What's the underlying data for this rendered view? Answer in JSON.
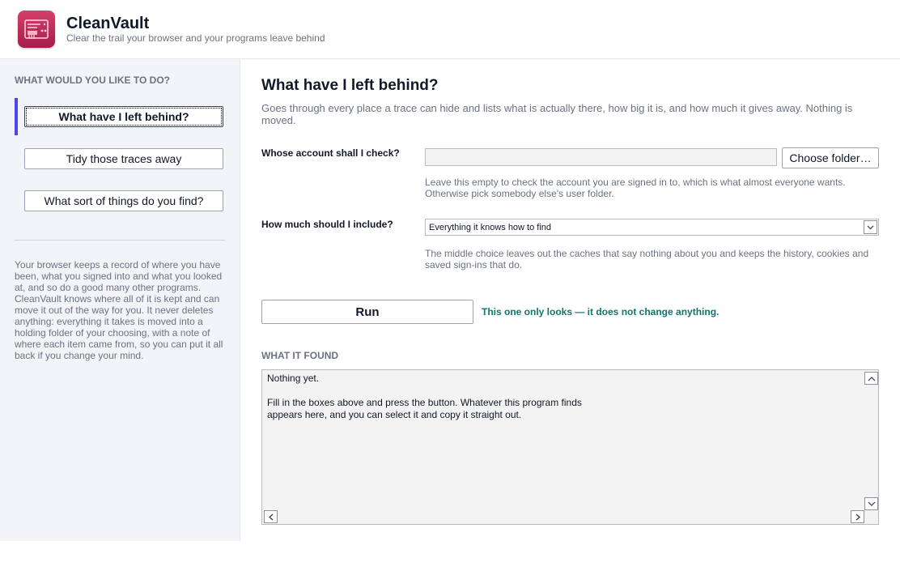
{
  "header": {
    "app_name": "CleanVault",
    "tagline": "Clear the trail your browser and your programs leave behind",
    "logo_icon": "broom-card-icon",
    "brand_color": "#c42d5c"
  },
  "sidebar": {
    "heading": "WHAT WOULD YOU LIKE TO DO?",
    "active_index": 0,
    "accent_color": "#4f46e5",
    "items": [
      {
        "label": "What have I left behind?"
      },
      {
        "label": "Tidy those traces away"
      },
      {
        "label": "What sort of things do you find?"
      }
    ],
    "about": "Your browser keeps a record of where you have been, what you signed into and what you looked at, and so do a good many other programs. CleanVault knows where all of it is kept and can move it out of the way for you. It never deletes anything: everything it takes is moved into a holding folder of your choosing, with a note of where each item came from, so you can put it all back if you change your mind."
  },
  "main": {
    "title": "What have I left behind?",
    "description": "Goes through every place a trace can hide and lists what is actually there, how big it is, and how much it gives away. Nothing is moved.",
    "account": {
      "label": "Whose account shall I check?",
      "value": "",
      "button_label": "Choose folder…",
      "hint": "Leave this empty to check the account you are signed in to, which is what almost everyone wants. Otherwise pick somebody else's user folder."
    },
    "scope": {
      "label": "How much should I include?",
      "selected": "Everything it knows how to find",
      "hint": "The middle choice leaves out the caches that say nothing about you and keeps the history, cookies and saved sign-ins that do."
    },
    "run": {
      "label": "Run",
      "note": "This one only looks — it does not change anything.",
      "note_color": "#0f766e"
    },
    "results": {
      "heading": "WHAT IT FOUND",
      "text": "Nothing yet.\n\nFill in the boxes above and press the button. Whatever this program finds\nappears here, and you can select it and copy it straight out."
    }
  }
}
